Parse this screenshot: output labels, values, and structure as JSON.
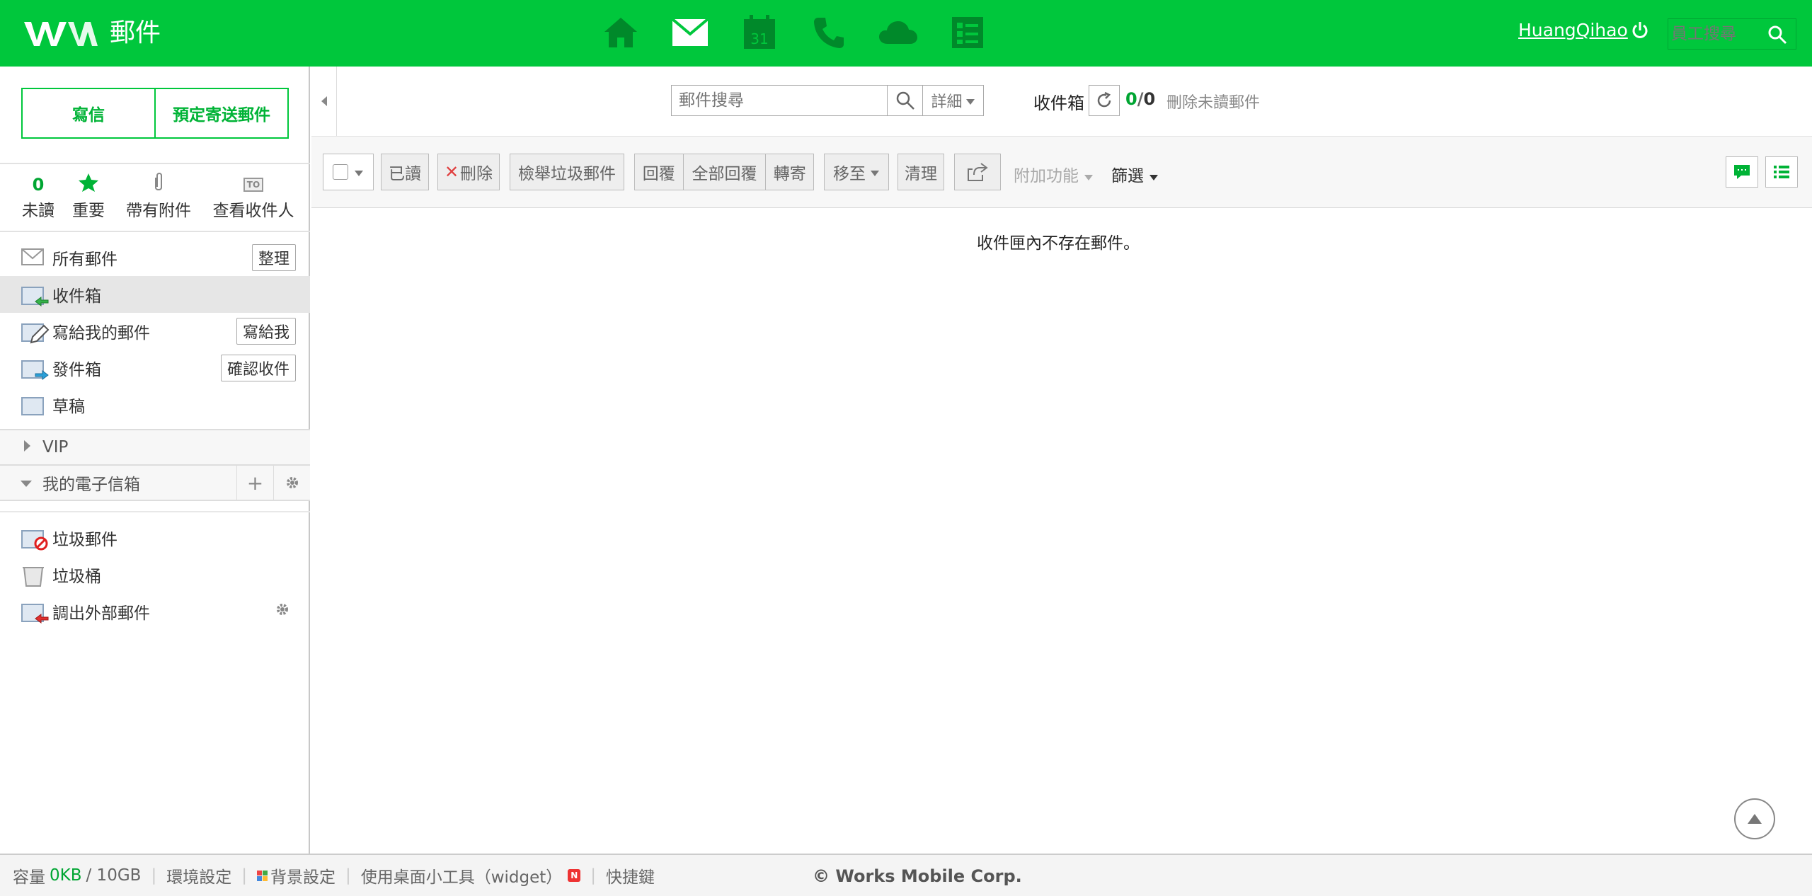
{
  "header": {
    "app_title": "郵件",
    "user_name": "HuangQihao",
    "employee_search_placeholder": "員工搜尋",
    "apps": [
      "home-icon",
      "mail-icon",
      "calendar-icon",
      "phone-icon",
      "cloud-icon",
      "board-icon"
    ],
    "calendar_day": "31",
    "brand_color": "#00c73c"
  },
  "sidebar": {
    "compose_label": "寫信",
    "schedule_label": "預定寄送郵件",
    "quick": {
      "unread_count": "0",
      "unread_label": "未讀",
      "important_label": "重要",
      "attachment_label": "帶有附件",
      "recipients_label": "查看收件人",
      "to_badge": "TO"
    },
    "folders": [
      {
        "label": "所有郵件",
        "button": "整理"
      },
      {
        "label": "收件箱"
      },
      {
        "label": "寫給我的郵件",
        "button": "寫給我"
      },
      {
        "label": "發件箱",
        "button": "確認收件"
      },
      {
        "label": "草稿"
      }
    ],
    "vip_label": "VIP",
    "my_mailbox_label": "我的電子信箱",
    "bottom_folders": [
      {
        "label": "垃圾郵件"
      },
      {
        "label": "垃圾桶"
      },
      {
        "label": "調出外部郵件"
      }
    ]
  },
  "main": {
    "search_placeholder": "郵件搜尋",
    "detail_label": "詳細",
    "mailbox_name": "收件箱",
    "unread_count": "0",
    "total_count": "0",
    "delete_unread_label": "刪除未讀郵件",
    "toolbar": {
      "read": "已讀",
      "delete": "刪除",
      "report_spam": "檢舉垃圾郵件",
      "reply": "回覆",
      "reply_all": "全部回覆",
      "forward": "轉寄",
      "move_to": "移至",
      "clean": "清理",
      "extra": "附加功能",
      "filter": "篩選"
    },
    "empty_message": "收件匣內不存在郵件。"
  },
  "footer": {
    "capacity_label": "容量",
    "used": "0KB",
    "total": "/ 10GB",
    "env_settings": "環境設定",
    "bg_settings": "背景設定",
    "widget": "使用桌面小工具（widget）",
    "widget_badge": "N",
    "shortcuts": "快捷鍵",
    "copyright": "© Works Mobile Corp."
  }
}
